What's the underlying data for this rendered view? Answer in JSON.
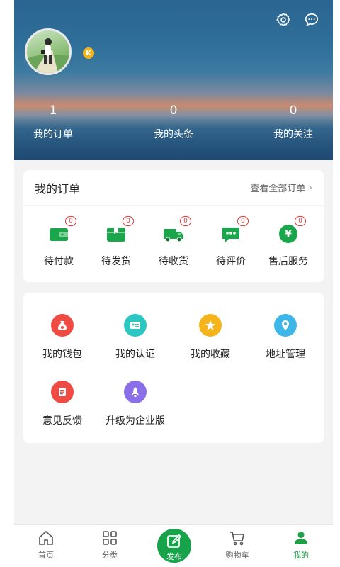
{
  "header": {
    "stats": [
      {
        "num": "1",
        "label": "我的订单"
      },
      {
        "num": "0",
        "label": "我的头条"
      },
      {
        "num": "0",
        "label": "我的关注"
      }
    ],
    "badge": "K",
    "icons": [
      "settings-icon",
      "message-icon"
    ]
  },
  "orders": {
    "title": "我的订单",
    "view_all": "查看全部订单",
    "items": [
      {
        "label": "待付款",
        "count": "0",
        "icon": "wallet-icon"
      },
      {
        "label": "待发货",
        "count": "0",
        "icon": "package-icon"
      },
      {
        "label": "待收货",
        "count": "0",
        "icon": "truck-icon"
      },
      {
        "label": "待评价",
        "count": "0",
        "icon": "comment-icon"
      },
      {
        "label": "售后服务",
        "count": "0",
        "icon": "yuan-icon"
      }
    ]
  },
  "services": {
    "items": [
      {
        "label": "我的钱包",
        "icon": "money-bag-icon",
        "color": "#f04b43"
      },
      {
        "label": "我的认证",
        "icon": "id-card-icon",
        "color": "#2dc7c3"
      },
      {
        "label": "我的收藏",
        "icon": "star-icon",
        "color": "#f4b41a"
      },
      {
        "label": "地址管理",
        "icon": "location-icon",
        "color": "#3fb6e8"
      },
      {
        "label": "意见反馈",
        "icon": "feedback-icon",
        "color": "#f04b43"
      },
      {
        "label": "升级为企业版",
        "icon": "rocket-icon",
        "color": "#8a6fe8"
      }
    ]
  },
  "nav": {
    "items": [
      {
        "label": "首页",
        "icon": "home-icon"
      },
      {
        "label": "分类",
        "icon": "grid-icon"
      },
      {
        "label": "发布",
        "icon": "edit-icon"
      },
      {
        "label": "购物车",
        "icon": "cart-icon"
      },
      {
        "label": "我的",
        "icon": "user-icon"
      }
    ],
    "active": "我的",
    "accent": "#1f9f47"
  }
}
